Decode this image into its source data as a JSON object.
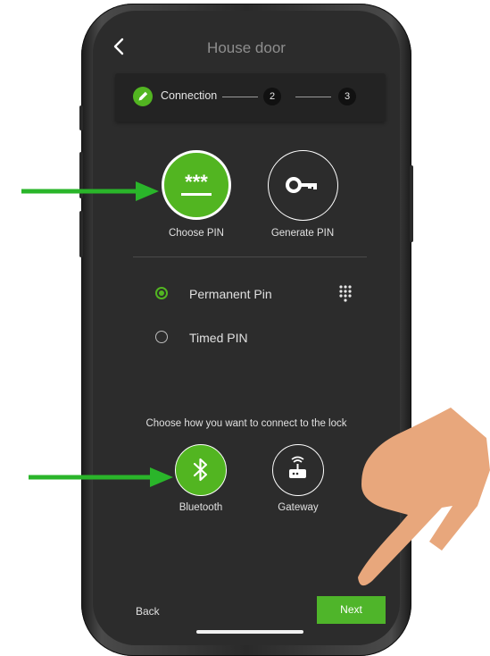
{
  "header": {
    "title": "House door"
  },
  "stepper": {
    "step1_label": "Connection",
    "step2_number": "2",
    "step3_number": "3"
  },
  "pin_options": [
    {
      "label": "Choose PIN",
      "icon": "pin-dots-icon",
      "selected": true
    },
    {
      "label": "Generate PIN",
      "icon": "key-icon",
      "selected": false
    }
  ],
  "pin_types": [
    {
      "label": "Permanent Pin",
      "selected": true
    },
    {
      "label": "Timed PIN",
      "selected": false
    }
  ],
  "connect_prompt": "Choose how you want to connect to the lock",
  "connect_options": [
    {
      "label": "Bluetooth",
      "icon": "bluetooth-icon",
      "selected": true
    },
    {
      "label": "Gateway",
      "icon": "gateway-icon",
      "selected": false
    }
  ],
  "footer": {
    "back_label": "Back",
    "next_label": "Next"
  },
  "colors": {
    "accent": "#52b521",
    "screen_bg": "#2c2c2c",
    "annotation_arrow": "#2ab52a",
    "hand": "#e8a77c"
  }
}
